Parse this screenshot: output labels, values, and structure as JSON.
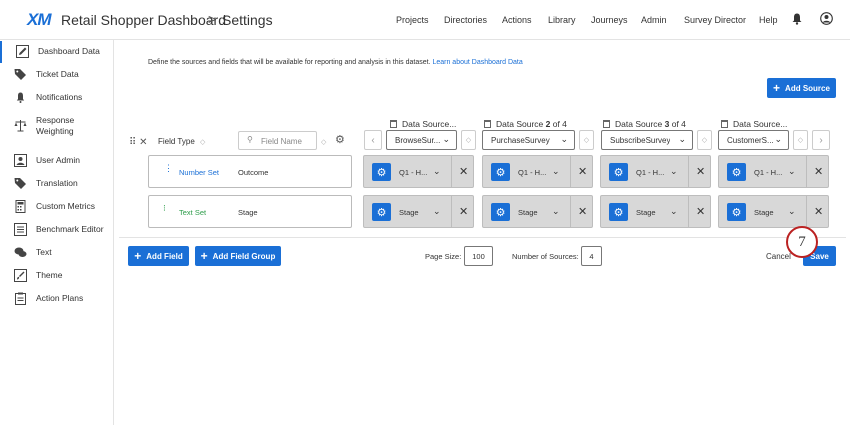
{
  "header": {
    "logo": "XM",
    "app_title": "Retail Shopper Dashboard",
    "breadcrumb_sep": ">",
    "breadcrumb": "Settings",
    "nav": [
      "Projects",
      "Directories",
      "Actions",
      "Library",
      "Journeys",
      "Admin",
      "Survey Director",
      "Help"
    ]
  },
  "sidebar": {
    "items": [
      {
        "label": "Dashboard Data",
        "icon": "pencil-box-icon",
        "active": true
      },
      {
        "label": "Ticket Data",
        "icon": "tags-icon"
      },
      {
        "label": "Notifications",
        "icon": "bell-icon"
      },
      {
        "label": "Response Weighting",
        "icon": "scale-icon"
      },
      {
        "label": "User Admin",
        "icon": "user-card-icon"
      },
      {
        "label": "Translation",
        "icon": "tag-icon"
      },
      {
        "label": "Custom Metrics",
        "icon": "calculator-icon"
      },
      {
        "label": "Benchmark Editor",
        "icon": "list-box-icon"
      },
      {
        "label": "Text",
        "icon": "chat-bubbles-icon"
      },
      {
        "label": "Theme",
        "icon": "paint-icon"
      },
      {
        "label": "Action Plans",
        "icon": "clipboard-icon"
      }
    ]
  },
  "main": {
    "description": "Define the sources and fields that will be available for reporting and analysis in this dataset.",
    "description_link": "Learn about Dashboard Data",
    "add_source_label": "Add Source",
    "field_type_label": "Field Type",
    "search_placeholder": "Field Name",
    "sources": [
      {
        "header_prefix": "Data Source...",
        "header_bold": "",
        "header_suffix": "",
        "selected": "BrowseSur..."
      },
      {
        "header_prefix": "Data Source ",
        "header_bold": "2",
        "header_suffix": " of 4",
        "selected": "PurchaseSurvey"
      },
      {
        "header_prefix": "Data Source ",
        "header_bold": "3",
        "header_suffix": " of 4",
        "selected": "SubscribeSurvey"
      },
      {
        "header_prefix": "Data Source...",
        "header_bold": "",
        "header_suffix": "",
        "selected": "CustomerS..."
      }
    ],
    "fields": [
      {
        "type": "Number Set",
        "type_color": "#1a6fd6",
        "name": "Outcome",
        "mappings": [
          "Q1 - H...",
          "Q1 - H...",
          "Q1 - H...",
          "Q1 - H..."
        ]
      },
      {
        "type": "Text Set",
        "type_color": "#2e9d4b",
        "name": "Stage",
        "mappings": [
          "Stage",
          "Stage",
          "Stage",
          "Stage"
        ]
      }
    ],
    "add_field_label": "Add Field",
    "add_field_group_label": "Add Field Group",
    "page_size_label": "Page Size:",
    "page_size_value": "100",
    "num_sources_label": "Number of Sources:",
    "num_sources_value": "4",
    "cancel_label": "Cancel",
    "save_label": "Save",
    "step_number": "7"
  },
  "colors": {
    "accent": "#1a6fd6",
    "text_set": "#2e9d4b",
    "step_ring": "#b22222"
  }
}
